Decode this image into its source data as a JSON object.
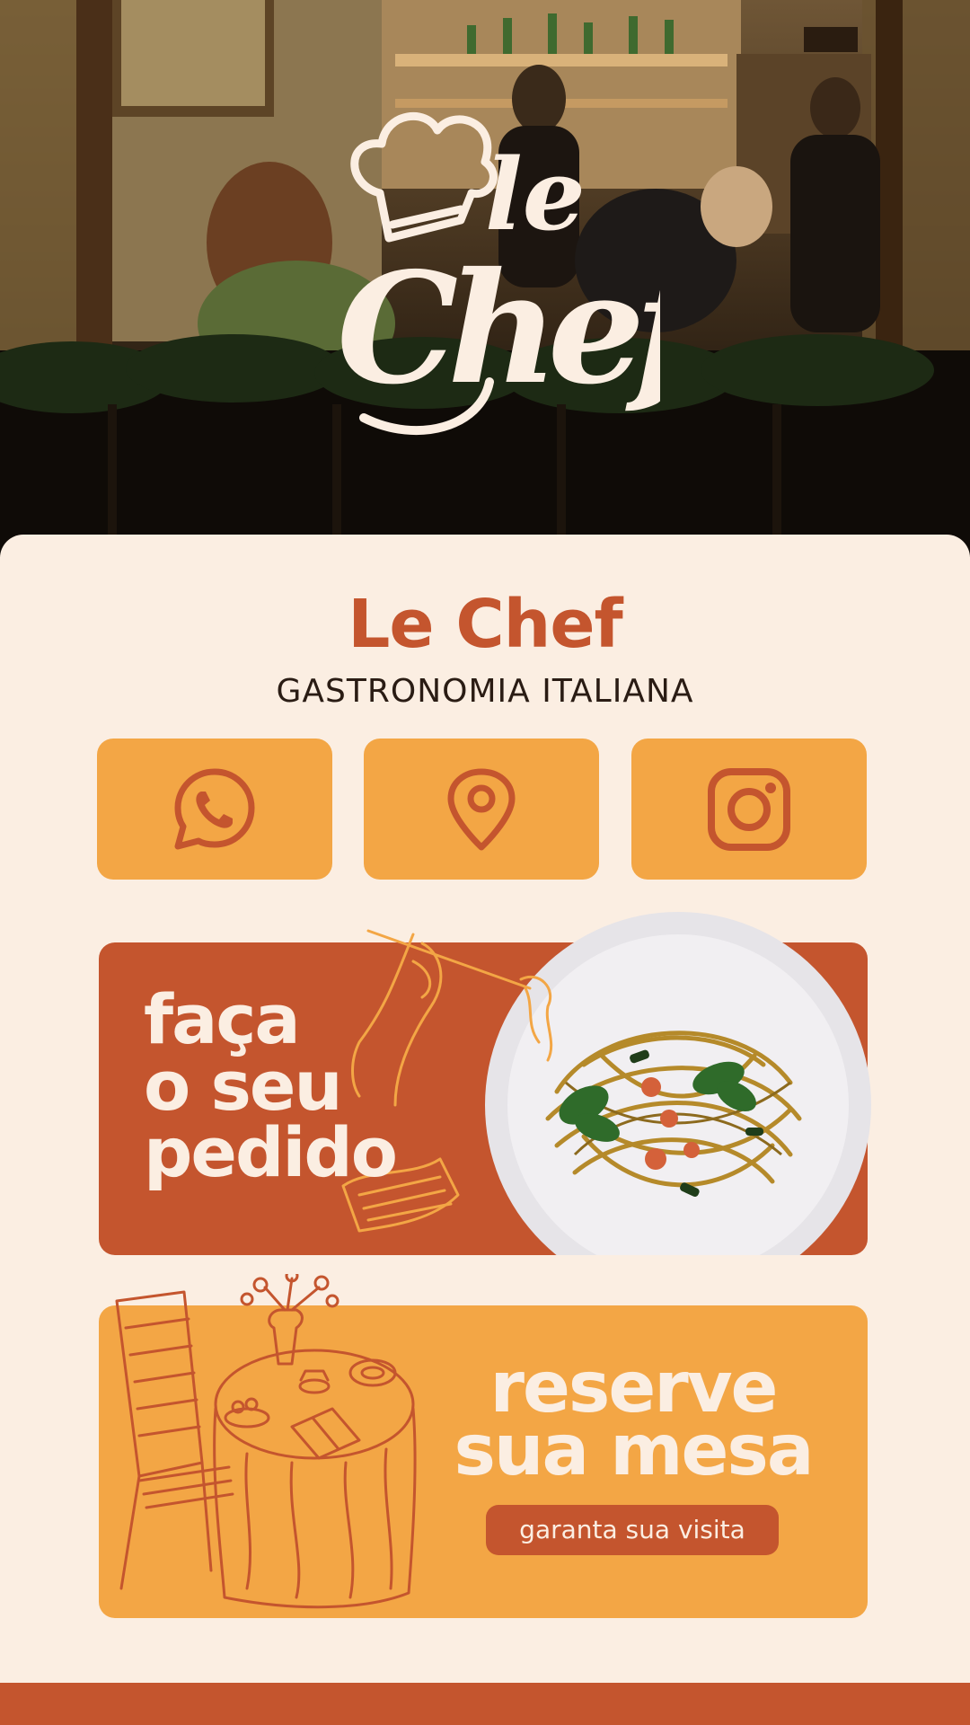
{
  "brand": {
    "logo_text": "le Chef",
    "name": "Le Chef",
    "tagline": "GASTRONOMIA ITALIANA"
  },
  "colors": {
    "primary": "#c4552e",
    "accent": "#f3a645",
    "background": "#fbeee2",
    "text_dark": "#2a1c14"
  },
  "contact_buttons": [
    {
      "icon": "whatsapp-icon"
    },
    {
      "icon": "location-pin-icon"
    },
    {
      "icon": "instagram-icon"
    }
  ],
  "order_banner": {
    "line1": "faça",
    "line2": "o seu",
    "line3": "pedido"
  },
  "reserve_banner": {
    "line1": "reserve",
    "line2": "sua mesa",
    "cta": "garanta sua visita"
  }
}
